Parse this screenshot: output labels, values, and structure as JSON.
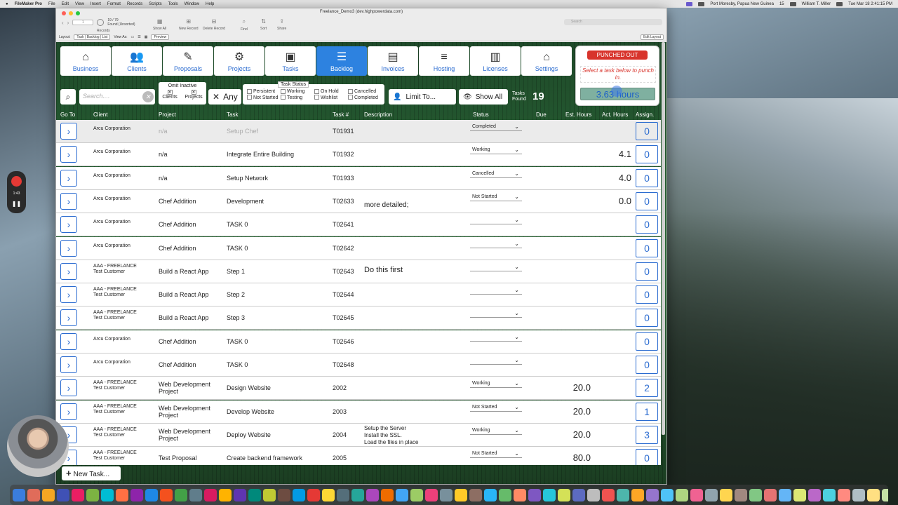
{
  "menubar": {
    "app": "FileMaker Pro",
    "items": [
      "File",
      "Edit",
      "View",
      "Insert",
      "Format",
      "Records",
      "Scripts",
      "Tools",
      "Window",
      "Help"
    ],
    "location": "Port Moresby, Papua New Guinea",
    "user": "William T. Miller",
    "clock": "Tue Mar 18  2:41:15 PM",
    "badge": "15"
  },
  "window": {
    "title": "Freelance_Demo3 (dev.highpowerdata.com)",
    "record_box": "1",
    "records_found": "19 / 79",
    "found_label": "Found (Unsorted)",
    "records_label": "Records",
    "toolbar": [
      "Show All",
      "New Record",
      "Delete Record",
      "Find",
      "Sort",
      "Share"
    ],
    "search_placeholder": "Search",
    "layout_label": "Layout:",
    "layout_value": "Task | Backlog | List",
    "view_as": "View As:",
    "preview": "Preview",
    "edit_layout": "Edit Layout"
  },
  "nav": [
    {
      "label": "Business",
      "icon": "home-icon",
      "glyph": "⌂"
    },
    {
      "label": "Clients",
      "icon": "people-icon",
      "glyph": "👥"
    },
    {
      "label": "Proposals",
      "icon": "pencil-icon",
      "glyph": "✎"
    },
    {
      "label": "Projects",
      "icon": "gears-icon",
      "glyph": "⚙"
    },
    {
      "label": "Tasks",
      "icon": "box-icon",
      "glyph": "▣"
    },
    {
      "label": "Backlog",
      "icon": "list-icon",
      "glyph": "☰"
    },
    {
      "label": "Invoices",
      "icon": "newspaper-icon",
      "glyph": "▤"
    },
    {
      "label": "Hosting",
      "icon": "database-icon",
      "glyph": "≡"
    },
    {
      "label": "Licenses",
      "icon": "document-icon",
      "glyph": "▥"
    },
    {
      "label": "Settings",
      "icon": "house-gear-icon",
      "glyph": "⌂"
    }
  ],
  "punch": {
    "button": "PUNCHED OUT",
    "message": "Select a task below to punch in.",
    "hours": "3.63 hours"
  },
  "filters": {
    "search_placeholder": "Search....",
    "omit_title": "Omit Inactive",
    "omit_clients": "Clients",
    "omit_projects": "Projects",
    "any": "Any",
    "status_title": "Task Status",
    "statuses": [
      "Persistent",
      "Working",
      "On Hold",
      "Cancelled",
      "Not Started",
      "Testing",
      "Wishlist",
      "Completed"
    ],
    "limit": "Limit To...",
    "show_all": "Show All",
    "tasks_found_label_1": "Tasks",
    "tasks_found_label_2": "Found",
    "tasks_found": "19"
  },
  "columns": [
    "Go To",
    "Client",
    "Project",
    "Task",
    "Task #",
    "Description",
    "Status",
    "Due",
    "Est. Hours",
    "Act. Hours",
    "Assign."
  ],
  "rows": [
    {
      "client": "Arcu Corporation",
      "project": "n/a",
      "task": "Setup Chef",
      "num": "T01931",
      "desc": "",
      "status": "Completed",
      "est": "",
      "act": "",
      "assign": "0",
      "inactive": true
    },
    {
      "client": "Arcu Corporation",
      "project": "n/a",
      "task": "Integrate Entire Building",
      "num": "T01932",
      "desc": "",
      "status": "Working",
      "est": "",
      "act": "4.1",
      "assign": "0"
    },
    {
      "client": "Arcu Corporation",
      "project": "n/a",
      "task": "Setup Network",
      "num": "T01933",
      "desc": "",
      "status": "Cancelled",
      "est": "",
      "act": "4.0",
      "assign": "0"
    },
    {
      "client": "Arcu Corporation",
      "project": "Chef Addition",
      "task": "Development",
      "num": "T02633",
      "desc": "more detailed;",
      "status": "Not Started",
      "est": "",
      "act": "0.0",
      "assign": "0",
      "desc_offset": true
    },
    {
      "client": "Arcu Corporation",
      "project": "Chef Addition",
      "task": "TASK 0",
      "num": "T02641",
      "desc": "",
      "status": "",
      "est": "",
      "act": "",
      "assign": "0"
    },
    {
      "client": "Arcu Corporation",
      "project": "Chef Addition",
      "task": "TASK 0",
      "num": "T02642",
      "desc": "",
      "status": "",
      "est": "",
      "act": "",
      "assign": "0"
    },
    {
      "client": "AAA - FREELANCE\nTest Customer",
      "project": "Build a React App",
      "task": "Step 1",
      "num": "T02643",
      "desc": "Do this first",
      "status": "",
      "est": "",
      "act": "",
      "assign": "0",
      "big": true
    },
    {
      "client": "AAA - FREELANCE\nTest Customer",
      "project": "Build a React App",
      "task": "Step 2",
      "num": "T02644",
      "desc": "",
      "status": "",
      "est": "",
      "act": "",
      "assign": "0"
    },
    {
      "client": "AAA - FREELANCE\nTest Customer",
      "project": "Build a React App",
      "task": "Step 3",
      "num": "T02645",
      "desc": "",
      "status": "",
      "est": "",
      "act": "",
      "assign": "0"
    },
    {
      "client": "Arcu Corporation",
      "project": "Chef Addition",
      "task": "TASK 0",
      "num": "T02646",
      "desc": "",
      "status": "",
      "est": "",
      "act": "",
      "assign": "0"
    },
    {
      "client": "Arcu Corporation",
      "project": "Chef Addition",
      "task": "TASK 0",
      "num": "T02648",
      "desc": "",
      "status": "",
      "est": "",
      "act": "",
      "assign": "0"
    },
    {
      "client": "AAA - FREELANCE\nTest Customer",
      "project": "Web Development\nProject",
      "task": "Design Website",
      "num": "2002",
      "desc": "",
      "status": "Working",
      "est": "20.0",
      "act": "",
      "assign": "2"
    },
    {
      "client": "AAA - FREELANCE\nTest Customer",
      "project": "Web Development\nProject",
      "task": "Develop Website",
      "num": "2003",
      "desc": "",
      "status": "Not Started",
      "est": "20.0",
      "act": "",
      "assign": "1"
    },
    {
      "client": "AAA - FREELANCE\nTest Customer",
      "project": "Web Development\nProject",
      "task": "Deploy Website",
      "num": "2004",
      "desc": "Setup the Server\nInstall the SSL.\nLoad the files in place",
      "status": "Working",
      "est": "20.0",
      "act": "",
      "assign": "3"
    },
    {
      "client": "AAA - FREELANCE\nTest Customer",
      "project": "Test Proposal",
      "task": "Create backend framework",
      "num": "2005",
      "desc": "",
      "status": "Not Started",
      "est": "80.0",
      "act": "",
      "assign": "0"
    }
  ],
  "new_task": "New Task...",
  "recording_time": "1:43"
}
